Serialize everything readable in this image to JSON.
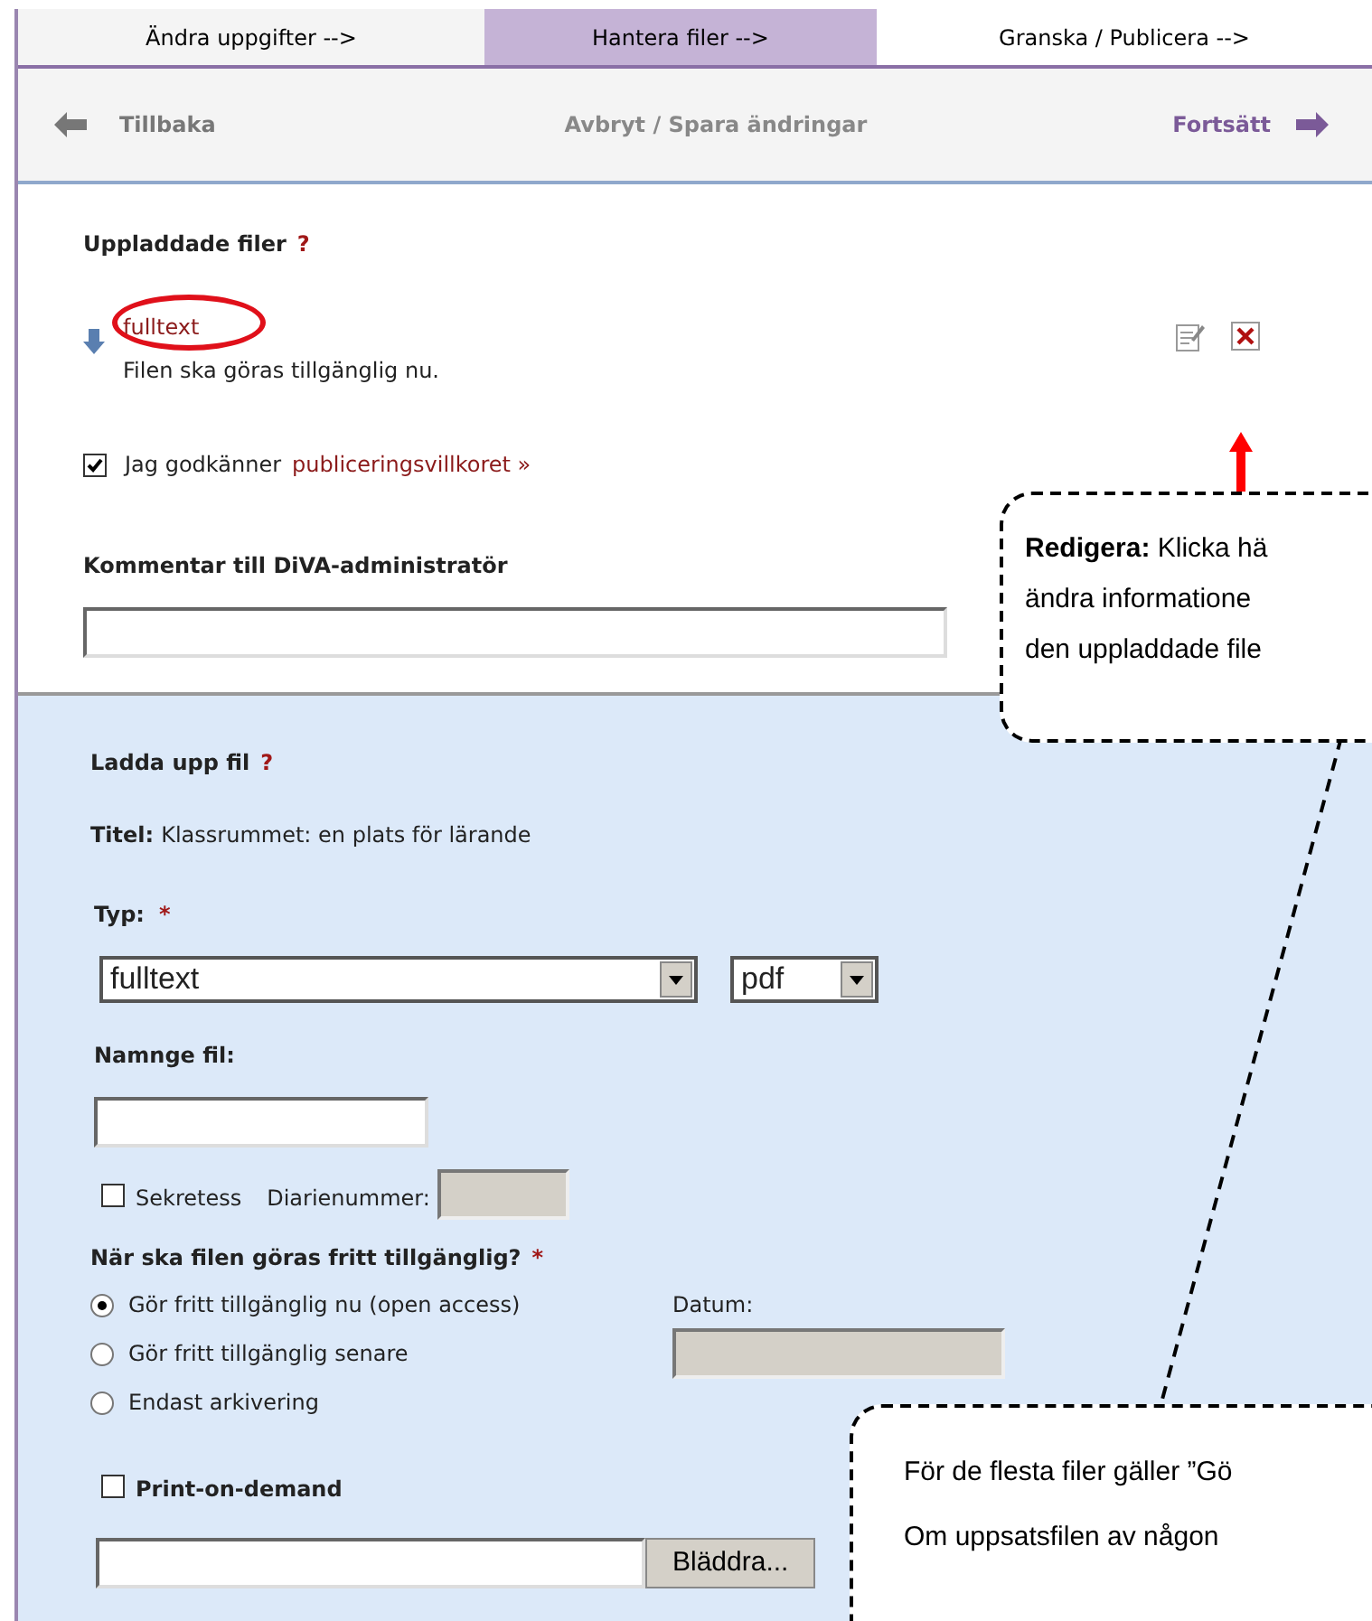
{
  "tabs": [
    {
      "label": "Ändra uppgifter -->",
      "selected": false
    },
    {
      "label": "Hantera filer -->",
      "selected": true
    },
    {
      "label": "Granska / Publicera -->",
      "selected": false
    }
  ],
  "nav": {
    "back": "Tillbaka",
    "middle": "Avbryt / Spara ändringar",
    "forward": "Fortsätt"
  },
  "uploaded": {
    "heading": "Uppladdade filer",
    "help": "?",
    "files": [
      {
        "name": "fulltext",
        "note": "Filen ska göras tillgänglig nu.",
        "highlighted": true
      }
    ],
    "agree": {
      "text": "Jag godkänner",
      "link": "publiceringsvillkoret »",
      "checked": true
    },
    "comment_label": "Kommentar till DiVA-administratör"
  },
  "upload": {
    "heading": "Ladda upp fil",
    "help": "?",
    "title_label": "Titel:",
    "title_value": "Klassrummet: en plats för lärande",
    "type_label": "Typ:",
    "required": "*",
    "type_value": "fulltext",
    "format_value": "pdf",
    "name_label": "Namnge fil:",
    "secrecy": {
      "label": "Sekretess",
      "checked": false
    },
    "diary_label": "Diarienummer:",
    "availability_label": "När ska filen göras fritt tillgänglig?",
    "availability_required": "*",
    "options": [
      {
        "label": "Gör fritt tillgänglig nu (open access)",
        "selected": true
      },
      {
        "label": "Gör fritt tillgänglig senare",
        "selected": false
      },
      {
        "label": "Endast arkivering",
        "selected": false
      }
    ],
    "date_label": "Datum:",
    "print": {
      "label": "Print-on-demand",
      "checked": false
    },
    "browse": "Bläddra..."
  },
  "callouts": [
    {
      "lines": [
        "**Redigera:** Klicka hä",
        "ändra informatione",
        "den uppladdade file"
      ]
    },
    {
      "lines": [
        "För de flesta filer gäller ”Gö",
        "Om uppsatsfilen av någon"
      ]
    }
  ]
}
